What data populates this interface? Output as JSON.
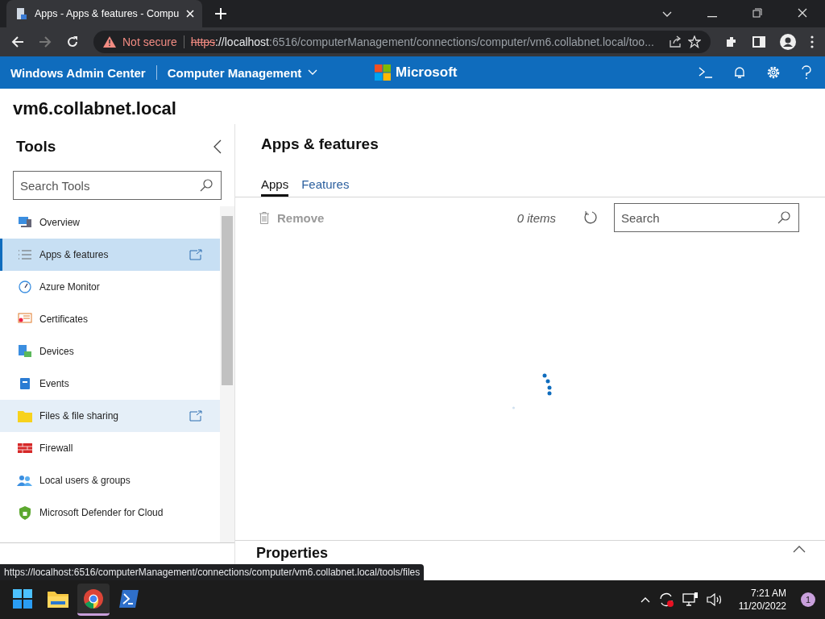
{
  "browser": {
    "tab_title": "Apps - Apps & features - Compu",
    "security": "Not secure",
    "url_scheme": "https",
    "url_host": "://localhost",
    "url_rest": ":6516/computerManagement/connections/computer/vm6.collabnet.local/too..."
  },
  "header": {
    "product": "Windows Admin Center",
    "context": "Computer Management",
    "brand": "Microsoft"
  },
  "server": "vm6.collabnet.local",
  "tools": {
    "title": "Tools",
    "search_placeholder": "Search Tools",
    "items": [
      {
        "label": "Overview",
        "selected": false,
        "hovered": false
      },
      {
        "label": "Apps & features",
        "selected": true,
        "hovered": false
      },
      {
        "label": "Azure Monitor",
        "selected": false,
        "hovered": false
      },
      {
        "label": "Certificates",
        "selected": false,
        "hovered": false
      },
      {
        "label": "Devices",
        "selected": false,
        "hovered": false
      },
      {
        "label": "Events",
        "selected": false,
        "hovered": false
      },
      {
        "label": "Files & file sharing",
        "selected": false,
        "hovered": true
      },
      {
        "label": "Firewall",
        "selected": false,
        "hovered": false
      },
      {
        "label": "Local users & groups",
        "selected": false,
        "hovered": false
      },
      {
        "label": "Microsoft Defender for Cloud",
        "selected": false,
        "hovered": false
      }
    ]
  },
  "main": {
    "title": "Apps & features",
    "tabs": [
      {
        "label": "Apps",
        "selected": true
      },
      {
        "label": "Features",
        "selected": false
      }
    ],
    "remove": {
      "label": "Remove",
      "disabled": true
    },
    "count": "0 items",
    "search_placeholder": "Search",
    "loading": true,
    "properties": "Properties"
  },
  "status_url": "https://localhost:6516/computerManagement/connections/computer/vm6.collabnet.local/tools/files",
  "taskbar": {
    "apps": [
      {
        "selected": false
      },
      {
        "selected": false
      },
      {
        "selected": true
      },
      {
        "selected": false
      }
    ],
    "time": "7:21 AM",
    "date": "11/20/2022",
    "notifications": "1"
  }
}
